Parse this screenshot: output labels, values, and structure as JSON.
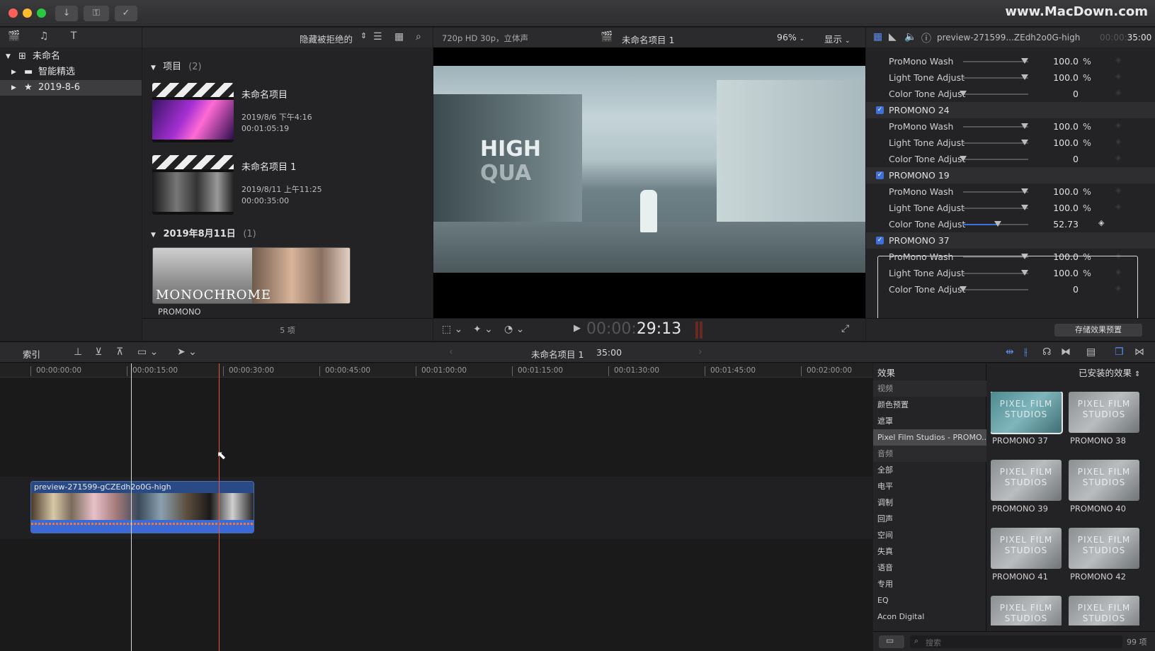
{
  "window": {
    "watermark": "www.MacDown.com"
  },
  "library": {
    "root": "未命名",
    "items": [
      {
        "label": "智能精选"
      },
      {
        "label": "2019-8-6"
      }
    ]
  },
  "browser": {
    "filter_label": "隐藏被拒绝的",
    "projects_section": "项目",
    "projects_count": "(2)",
    "projects": [
      {
        "name": "未命名项目",
        "date": "2019/8/6 下午4:16",
        "duration": "00:01:05:19"
      },
      {
        "name": "未命名项目 1",
        "date": "2019/8/11 上午11:25",
        "duration": "00:00:35:00"
      }
    ],
    "event_section": "2019年8月11日",
    "event_count": "(1)",
    "clip_name": "PROMONO",
    "clip_overlay_text": "MONOCHROME",
    "footer_count": "5 项"
  },
  "viewer": {
    "format": "720p HD 30p，立体声",
    "project_title": "未命名项目 1",
    "zoom": "96%",
    "display_label": "显示",
    "timecode_dim": "00:00:",
    "timecode_bright": "29:13",
    "overlay_text": [
      "HIGH",
      "QUA"
    ]
  },
  "inspector": {
    "clip_name": "preview-271599...ZEdh2o0G-high",
    "clip_duration": "35:00",
    "clip_duration_dim": "00:00:",
    "rows": [
      {
        "kind": "param",
        "label": "ProMono Wash",
        "value": "100.0",
        "unit": "%",
        "level": 0.95
      },
      {
        "kind": "param",
        "label": "Light Tone Adjust",
        "value": "100.0",
        "unit": "%",
        "level": 0.95
      },
      {
        "kind": "param",
        "label": "Color Tone Adjust",
        "value": "0",
        "unit": "",
        "level": 0.0
      },
      {
        "kind": "group",
        "label": "PROMONO 24"
      },
      {
        "kind": "param",
        "label": "ProMono Wash",
        "value": "100.0",
        "unit": "%",
        "level": 0.95
      },
      {
        "kind": "param",
        "label": "Light Tone Adjust",
        "value": "100.0",
        "unit": "%",
        "level": 0.95
      },
      {
        "kind": "param",
        "label": "Color Tone Adjust",
        "value": "0",
        "unit": "",
        "level": 0.0
      },
      {
        "kind": "group",
        "label": "PROMONO 19"
      },
      {
        "kind": "param",
        "label": "ProMono Wash",
        "value": "100.0",
        "unit": "%",
        "level": 0.95
      },
      {
        "kind": "param",
        "label": "Light Tone Adjust",
        "value": "100.0",
        "unit": "%",
        "level": 0.95
      },
      {
        "kind": "param",
        "label": "Color Tone Adjust",
        "value": "52.73",
        "unit": "",
        "level": 0.5273,
        "active": true
      },
      {
        "kind": "group",
        "label": "PROMONO 37"
      },
      {
        "kind": "param",
        "label": "ProMono Wash",
        "value": "100.0",
        "unit": "%",
        "level": 0.95
      },
      {
        "kind": "param",
        "label": "Light Tone Adjust",
        "value": "100.0",
        "unit": "%",
        "level": 0.95
      },
      {
        "kind": "param",
        "label": "Color Tone Adjust",
        "value": "0",
        "unit": "",
        "level": 0.0
      }
    ],
    "save_preset": "存储效果预置"
  },
  "timeline": {
    "index_label": "索引",
    "project_title": "未命名项目 1",
    "project_duration": "35:00",
    "ruler": [
      "00:00:00:00",
      "00:00:15:00",
      "00:00:30:00",
      "00:00:45:00",
      "00:01:00:00",
      "00:01:15:00",
      "00:01:30:00",
      "00:01:45:00",
      "00:02:00:00"
    ],
    "clip_name": "preview-271599-gCZEdh2o0G-high"
  },
  "effects": {
    "title": "效果",
    "installed_label": "已安装的效果",
    "categories": [
      {
        "label": "视频",
        "head": true
      },
      {
        "label": "颜色预置"
      },
      {
        "label": "遮罩"
      },
      {
        "label": "Pixel Film Studios - PROMO...",
        "selected": true
      },
      {
        "label": "音频",
        "head": true
      },
      {
        "label": "全部"
      },
      {
        "label": "电平"
      },
      {
        "label": "调制"
      },
      {
        "label": "回声"
      },
      {
        "label": "空间"
      },
      {
        "label": "失真"
      },
      {
        "label": "语音"
      },
      {
        "label": "专用"
      },
      {
        "label": "EQ"
      },
      {
        "label": "Acon Digital"
      }
    ],
    "items": [
      {
        "name": "PROMONO 37",
        "thumb_text": "PIXEL FILM STUDIOS",
        "selected": true
      },
      {
        "name": "PROMONO 38",
        "thumb_text": "PIXEL FILM STUDIOS"
      },
      {
        "name": "PROMONO 39",
        "thumb_text": "PIXEL FILM STUDIOS"
      },
      {
        "name": "PROMONO 40",
        "thumb_text": "PIXEL FILM STUDIOS"
      },
      {
        "name": "PROMONO 41",
        "thumb_text": "PIXEL FILM STUDIOS"
      },
      {
        "name": "PROMONO 42",
        "thumb_text": "PIXEL FILM STUDIOS"
      },
      {
        "name": "",
        "thumb_text": "PIXEL FILM STUDIOS"
      },
      {
        "name": "",
        "thumb_text": "PIXEL FILM STUDIOS"
      }
    ],
    "search_placeholder": "搜索",
    "count": "99 项"
  }
}
